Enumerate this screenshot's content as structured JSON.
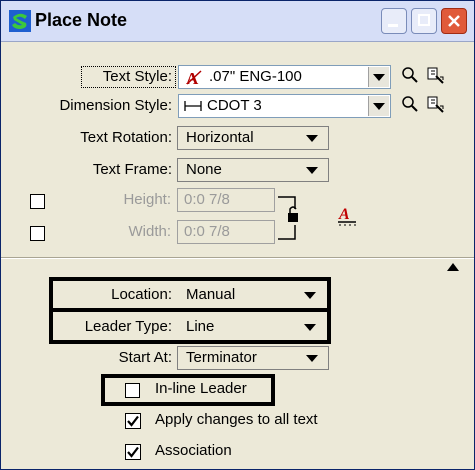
{
  "window": {
    "title": "Place Note"
  },
  "text_style": {
    "label": "Text Style:",
    "value": ".07\" ENG-100"
  },
  "dimension_style": {
    "label": "Dimension Style:",
    "value": "CDOT 3"
  },
  "text_rotation": {
    "label": "Text Rotation:",
    "value": "Horizontal"
  },
  "text_frame": {
    "label": "Text Frame:",
    "value": "None"
  },
  "height": {
    "label": "Height:",
    "value": "0:0 7/8"
  },
  "width": {
    "label": "Width:",
    "value": "0:0 7/8"
  },
  "location": {
    "label": "Location:",
    "value": "Manual"
  },
  "leader_type": {
    "label": "Leader Type:",
    "value": "Line"
  },
  "start_at": {
    "label": "Start At:",
    "value": "Terminator"
  },
  "inline_leader": {
    "label": "In-line Leader",
    "checked": false
  },
  "apply_changes": {
    "label": "Apply changes to all text",
    "checked": true
  },
  "association": {
    "label": "Association",
    "checked": true
  }
}
